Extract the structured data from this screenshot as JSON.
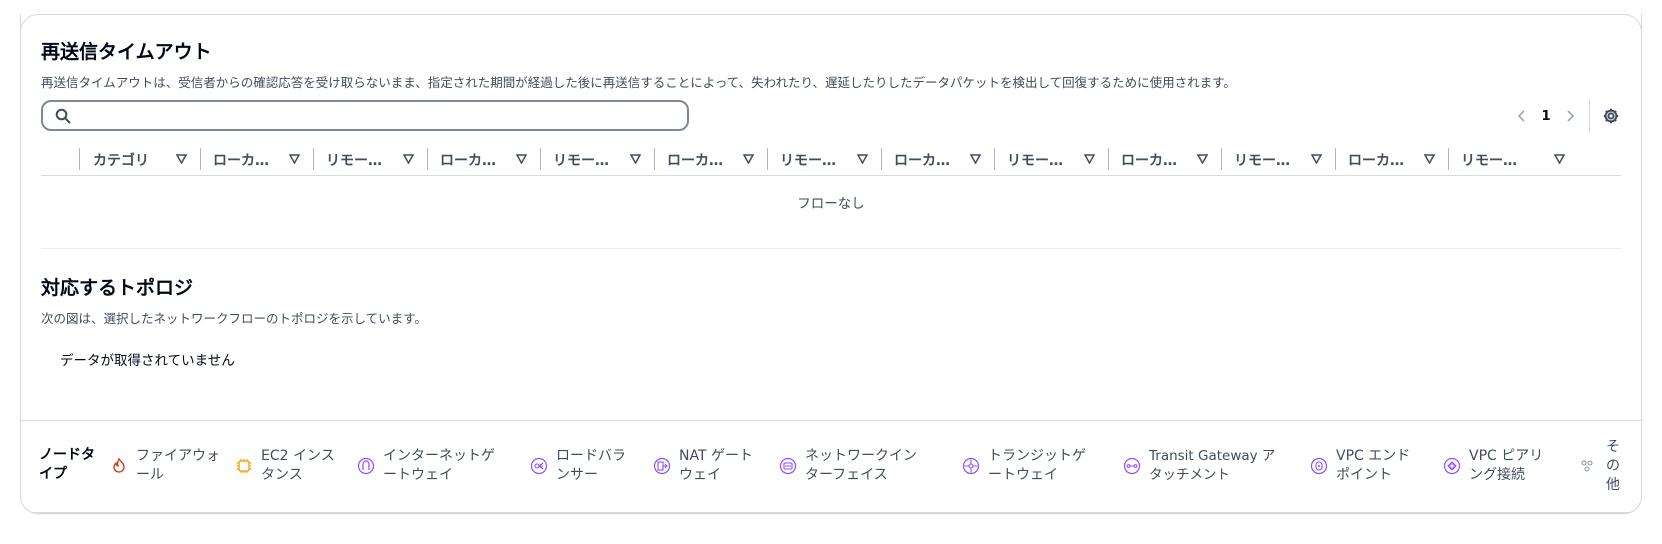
{
  "retransmit": {
    "title": "再送信タイムアウト",
    "description": "再送信タイムアウトは、受信者からの確認応答を受け取らないまま、指定された期間が経過した後に再送信することによって、失われたり、遅延したりしたデータパケットを検出して回復するために使用されます。",
    "search": {
      "value": "",
      "placeholder": ""
    },
    "pagination": {
      "current_page": "1"
    },
    "columns": [
      "カテゴリ",
      "ローカ…",
      "リモー…",
      "ローカ…",
      "リモー…",
      "ローカ…",
      "リモー…",
      "ローカ…",
      "リモー…",
      "ローカ…",
      "リモー…",
      "ローカ…",
      "リモー…"
    ],
    "empty_text": "フローなし"
  },
  "topology": {
    "title": "対応するトポロジ",
    "description": "次の図は、選択したネットワークフローのトポロジを示しています。",
    "no_data": "データが取得されていません"
  },
  "legend": {
    "title": "ノードタイプ",
    "items": [
      {
        "label": "ファイアウォール",
        "icon": "firewall-icon",
        "color": "#d13212"
      },
      {
        "label": "EC2 インスタンス",
        "icon": "ec2-instance-icon",
        "color": "#ff9900"
      },
      {
        "label": "インターネットゲートウェイ",
        "icon": "internet-gateway-icon",
        "color": "#8c4fff"
      },
      {
        "label": "ロードバランサー",
        "icon": "load-balancer-icon",
        "color": "#8c4fff"
      },
      {
        "label": "NAT ゲートウェイ",
        "icon": "nat-gateway-icon",
        "color": "#8c4fff"
      },
      {
        "label": "ネットワークインターフェイス",
        "icon": "network-interface-icon",
        "color": "#8c4fff"
      },
      {
        "label": "トランジットゲートウェイ",
        "icon": "transit-gateway-icon",
        "color": "#8c4fff"
      },
      {
        "label": "Transit Gateway アタッチメント",
        "icon": "transit-gateway-attachment-icon",
        "color": "#8c4fff"
      },
      {
        "label": "VPC エンドポイント",
        "icon": "vpc-endpoint-icon",
        "color": "#8c4fff"
      },
      {
        "label": "VPC ピアリング接続",
        "icon": "vpc-peering-icon",
        "color": "#8c4fff"
      },
      {
        "label": "その他",
        "icon": "other-node-icon",
        "color": "#879596"
      }
    ]
  }
}
